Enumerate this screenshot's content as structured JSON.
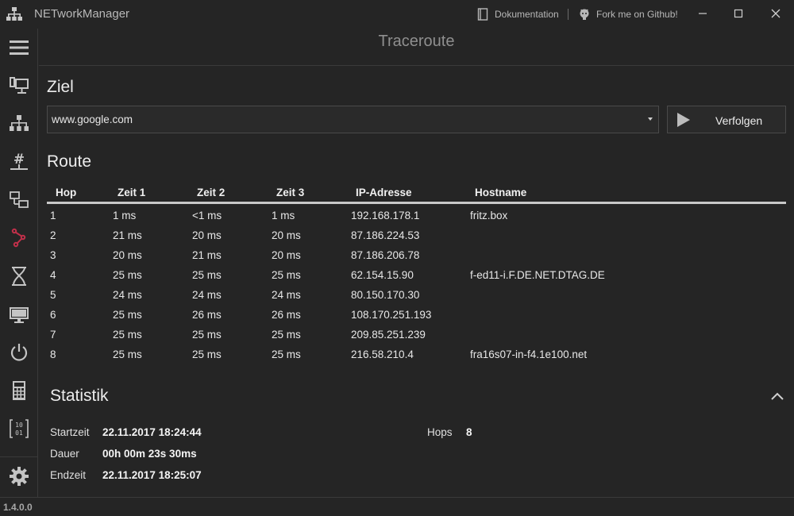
{
  "app": {
    "title": "NETworkManager",
    "version": "1.4.0.0",
    "links": {
      "docs": "Dokumentation",
      "github": "Fork me on Github!"
    }
  },
  "header": {
    "title": "Traceroute"
  },
  "sidebar": {
    "items": [
      {
        "icon": "network-interface-icon"
      },
      {
        "icon": "ip-scanner-icon"
      },
      {
        "icon": "subnet-calculator-icon"
      },
      {
        "icon": "port-scanner-icon"
      },
      {
        "icon": "traceroute-icon",
        "active": true
      },
      {
        "icon": "ping-icon"
      },
      {
        "icon": "remote-desktop-icon"
      },
      {
        "icon": "wake-on-lan-icon"
      },
      {
        "icon": "calculator-icon"
      },
      {
        "icon": "binary-lookup-icon"
      }
    ],
    "settings_icon": "gear-icon"
  },
  "target": {
    "heading": "Ziel",
    "value": "www.google.com",
    "button_label": "Verfolgen"
  },
  "route": {
    "heading": "Route",
    "columns": [
      "Hop",
      "Zeit 1",
      "Zeit 2",
      "Zeit 3",
      "IP-Adresse",
      "Hostname"
    ],
    "rows": [
      [
        "1",
        "1 ms",
        "<1 ms",
        "1 ms",
        "192.168.178.1",
        "fritz.box"
      ],
      [
        "2",
        "21 ms",
        "20 ms",
        "20 ms",
        "87.186.224.53",
        ""
      ],
      [
        "3",
        "20 ms",
        "21 ms",
        "20 ms",
        "87.186.206.78",
        ""
      ],
      [
        "4",
        "25 ms",
        "25 ms",
        "25 ms",
        "62.154.15.90",
        "f-ed11-i.F.DE.NET.DTAG.DE"
      ],
      [
        "5",
        "24 ms",
        "24 ms",
        "24 ms",
        "80.150.170.30",
        ""
      ],
      [
        "6",
        "25 ms",
        "26 ms",
        "26 ms",
        "108.170.251.193",
        ""
      ],
      [
        "7",
        "25 ms",
        "25 ms",
        "25 ms",
        "209.85.251.239",
        ""
      ],
      [
        "8",
        "25 ms",
        "25 ms",
        "25 ms",
        "216.58.210.4",
        "fra16s07-in-f4.1e100.net"
      ]
    ]
  },
  "statistics": {
    "heading": "Statistik",
    "start_label": "Startzeit",
    "start_value": "22.11.2017 18:24:44",
    "duration_label": "Dauer",
    "duration_value": "00h 00m 23s 30ms",
    "end_label": "Endzeit",
    "end_value": "22.11.2017 18:25:07",
    "hops_label": "Hops",
    "hops_value": "8"
  },
  "colors": {
    "accent": "#c0304a",
    "background": "#252525",
    "text": "#e6e6e6"
  }
}
